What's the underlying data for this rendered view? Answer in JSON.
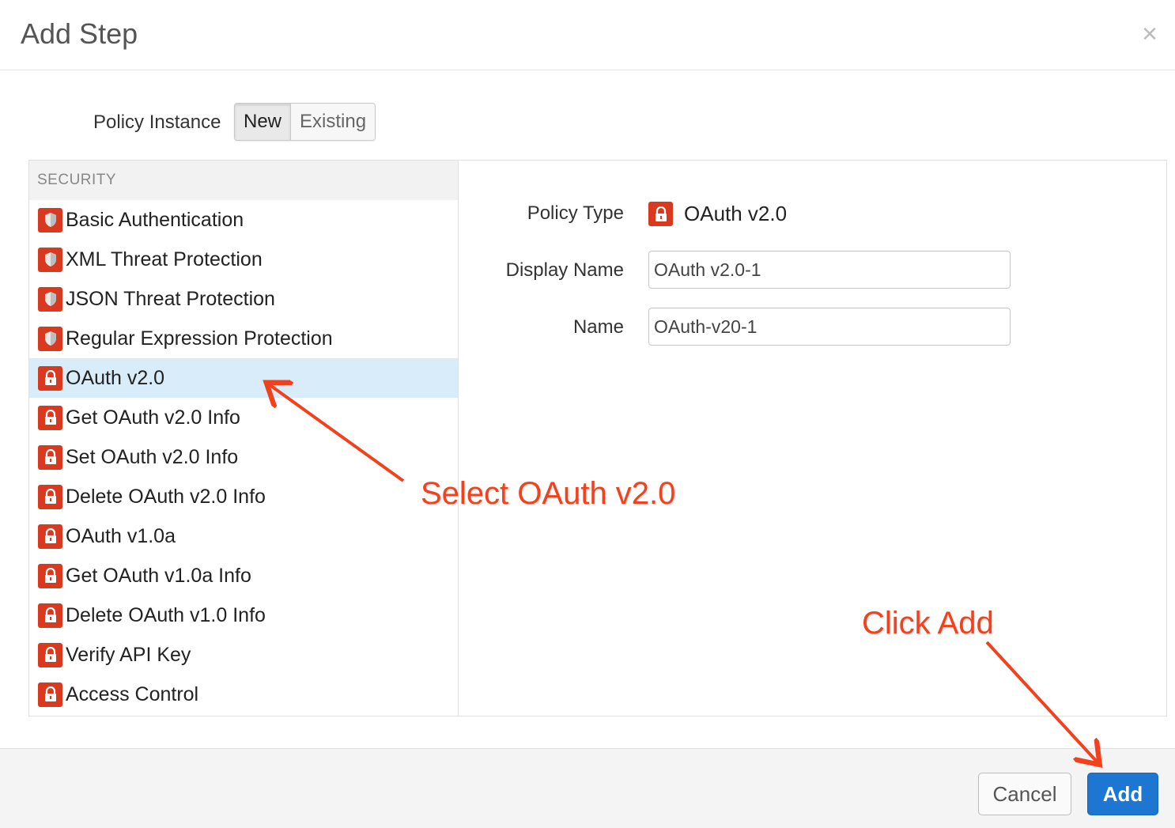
{
  "dialog": {
    "title": "Add Step",
    "close_glyph": "×"
  },
  "policy_instance": {
    "label": "Policy Instance",
    "options": [
      "New",
      "Existing"
    ],
    "selected": "New"
  },
  "policy_list": {
    "category": "SECURITY",
    "items": [
      {
        "label": "Basic Authentication",
        "icon": "shield-icon"
      },
      {
        "label": "XML Threat Protection",
        "icon": "shield-icon"
      },
      {
        "label": "JSON Threat Protection",
        "icon": "shield-icon"
      },
      {
        "label": "Regular Expression Protection",
        "icon": "shield-icon"
      },
      {
        "label": "OAuth v2.0",
        "icon": "lock-icon",
        "selected": true
      },
      {
        "label": "Get OAuth v2.0 Info",
        "icon": "lock-icon"
      },
      {
        "label": "Set OAuth v2.0 Info",
        "icon": "lock-icon"
      },
      {
        "label": "Delete OAuth v2.0 Info",
        "icon": "lock-icon"
      },
      {
        "label": "OAuth v1.0a",
        "icon": "lock-icon"
      },
      {
        "label": "Get OAuth v1.0a Info",
        "icon": "lock-icon"
      },
      {
        "label": "Delete OAuth v1.0 Info",
        "icon": "lock-icon"
      },
      {
        "label": "Verify API Key",
        "icon": "lock-icon"
      },
      {
        "label": "Access Control",
        "icon": "lock-icon"
      }
    ]
  },
  "details": {
    "policy_type_label": "Policy Type",
    "policy_type_value": "OAuth v2.0",
    "display_name_label": "Display Name",
    "display_name_value": "OAuth v2.0-1",
    "name_label": "Name",
    "name_value": "OAuth-v20-1"
  },
  "footer": {
    "cancel_label": "Cancel",
    "add_label": "Add"
  },
  "annotations": {
    "select_text": "Select OAuth v2.0",
    "click_text": "Click Add"
  },
  "colors": {
    "icon_red": "#d9391f",
    "selected_row": "#d9ecf9",
    "primary_blue": "#1c76d2",
    "annotation": "#f1421d"
  }
}
